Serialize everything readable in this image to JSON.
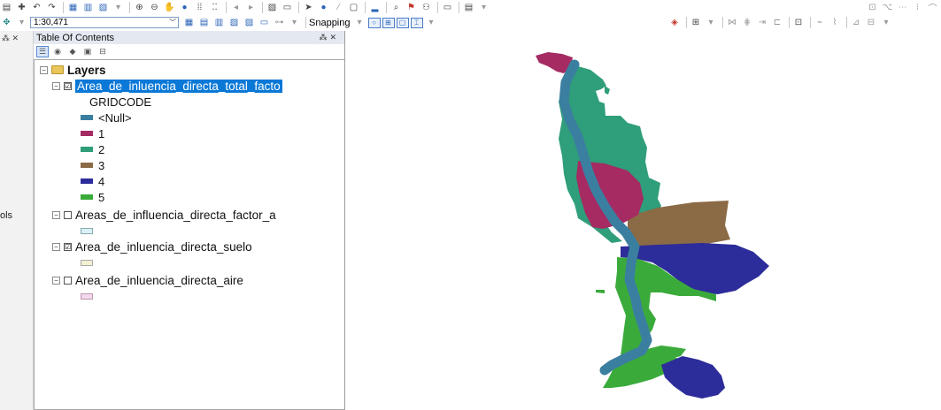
{
  "toolbar": {
    "scale_value": "1:30,471",
    "snapping_label": "Snapping"
  },
  "left_strip": {
    "tools_label": "ols"
  },
  "toc": {
    "title": "Table Of Contents",
    "root_label": "Layers",
    "layers": [
      {
        "label": "Area_de_inluencia_directa_total_facto",
        "checked": true,
        "selected": true,
        "field": "GRIDCODE",
        "classes": [
          {
            "label": "<Null>",
            "color": "#3b7fa0"
          },
          {
            "label": "1",
            "color": "#a52b62"
          },
          {
            "label": "2",
            "color": "#2f9e7a"
          },
          {
            "label": "3",
            "color": "#8b6a46"
          },
          {
            "label": "4",
            "color": "#2c2c9a"
          },
          {
            "label": "5",
            "color": "#3aab3a"
          }
        ]
      },
      {
        "label": "Areas_de_influencia_directa_factor_a",
        "checked": false,
        "swatch_color": "#d9f1f7"
      },
      {
        "label": "Area_de_inluencia_directa_suelo",
        "checked": true,
        "swatch_color": "#f3f1cf"
      },
      {
        "label": "Area_de_inluencia_directa_aire",
        "checked": false,
        "swatch_color": "#f4d8ef"
      }
    ]
  },
  "map": {
    "colors": {
      "null_river": "#3b7fa0",
      "class1": "#a52b62",
      "class2": "#2f9e7a",
      "class3": "#8b6a46",
      "class4": "#2c2c9a",
      "class5": "#3aab3a"
    }
  }
}
